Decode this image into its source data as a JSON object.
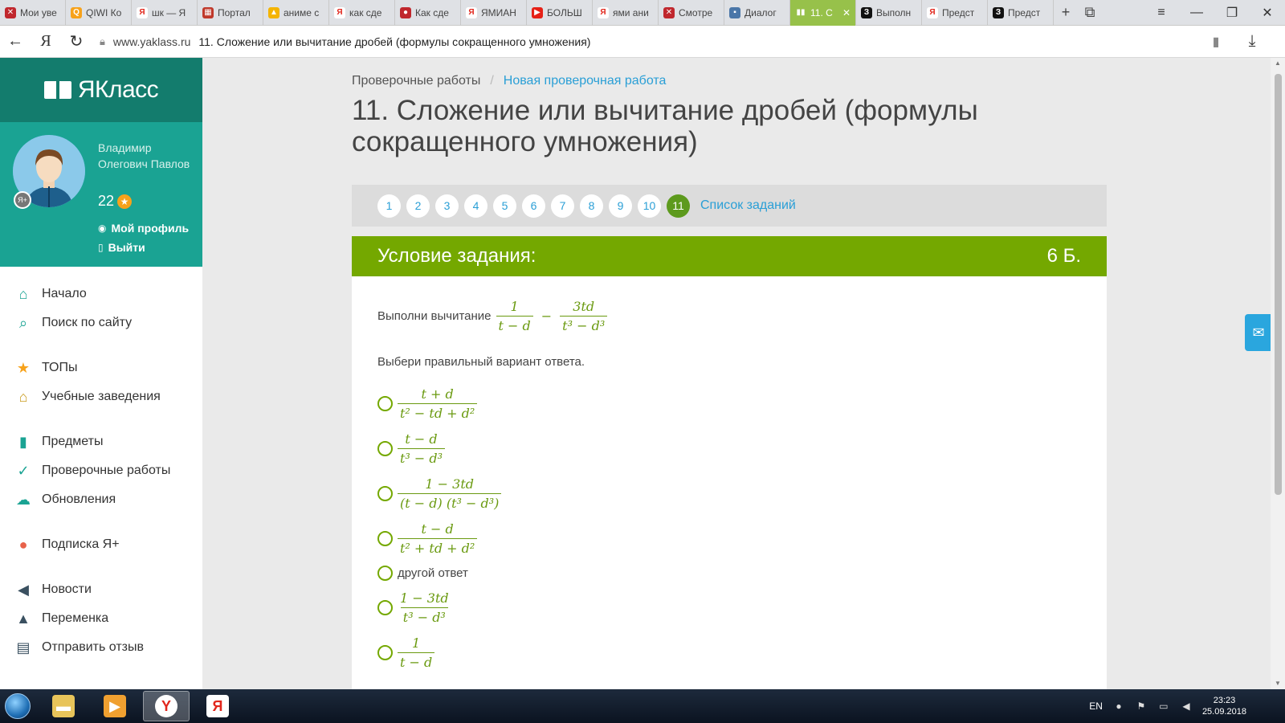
{
  "browser": {
    "tabs": [
      {
        "label": "Мои уве",
        "icon": "opera-icon",
        "color": "#c0272d",
        "glyph": "✕"
      },
      {
        "label": "QIWI Ко",
        "icon": "qiwi-icon",
        "color": "#f7a21b",
        "glyph": "Q"
      },
      {
        "label": "шк — Я",
        "icon": "yandex-icon",
        "color": "#ffffff",
        "glyph": "Я"
      },
      {
        "label": "Портал",
        "icon": "portal-icon",
        "color": "#c0392b",
        "glyph": "▦"
      },
      {
        "label": "аниме с",
        "icon": "image-icon",
        "color": "#f4b400",
        "glyph": "▲"
      },
      {
        "label": "как сде",
        "icon": "yandex-icon",
        "color": "#ffffff",
        "glyph": "Я"
      },
      {
        "label": "Как сде",
        "icon": "record-icon",
        "color": "#c0272d",
        "glyph": "●"
      },
      {
        "label": "ЯМИАН",
        "icon": "yandex-icon",
        "color": "#ffffff",
        "glyph": "Я"
      },
      {
        "label": "БОЛЬШ",
        "icon": "youtube-icon",
        "color": "#e62117",
        "glyph": "▶"
      },
      {
        "label": "ями ани",
        "icon": "yandex-icon",
        "color": "#ffffff",
        "glyph": "Я"
      },
      {
        "label": "Смотре",
        "icon": "opera-icon",
        "color": "#c0272d",
        "glyph": "✕"
      },
      {
        "label": "Диалог",
        "icon": "chat-icon",
        "color": "#4a76a8",
        "glyph": "▪"
      },
      {
        "label": "11. С",
        "icon": "yaklass-icon",
        "color": "#97c14a",
        "glyph": "▮▮",
        "active": true
      },
      {
        "label": "Выполн",
        "icon": "znanija-icon",
        "color": "#111111",
        "glyph": "З"
      },
      {
        "label": "Предст",
        "icon": "yandex-icon",
        "color": "#ffffff",
        "glyph": "Я"
      },
      {
        "label": "Предст",
        "icon": "znanija-icon",
        "color": "#111111",
        "glyph": "З"
      }
    ],
    "address": {
      "domain": "www.yaklass.ru",
      "page_title": "11. Сложение или вычитание дробей (формулы сокращенного умножения)"
    }
  },
  "sidebar": {
    "logo": "ЯКласс",
    "user": {
      "name": "Владимир Олегович Павлов",
      "points": "22",
      "profile_link": "Мой профиль",
      "logout_link": "Выйти"
    },
    "menu": [
      {
        "label": "Начало",
        "icon": "home-icon",
        "glyph": "⌂"
      },
      {
        "label": "Поиск по сайту",
        "icon": "search-icon",
        "glyph": "⌕"
      },
      {
        "label": "ТОПы",
        "icon": "star-icon",
        "glyph": "★"
      },
      {
        "label": "Учебные заведения",
        "icon": "school-icon",
        "glyph": "⌂"
      },
      {
        "label": "Предметы",
        "icon": "books-icon",
        "glyph": "▮"
      },
      {
        "label": "Проверочные работы",
        "icon": "check-circle-icon",
        "glyph": "✓"
      },
      {
        "label": "Обновления",
        "icon": "cloud-icon",
        "glyph": "☁"
      },
      {
        "label": "Подписка Я+",
        "icon": "yaplus-icon",
        "glyph": "●"
      },
      {
        "label": "Новости",
        "icon": "megaphone-icon",
        "glyph": "◀"
      },
      {
        "label": "Переменка",
        "icon": "bell-icon",
        "glyph": "▲"
      },
      {
        "label": "Отправить отзыв",
        "icon": "comment-icon",
        "glyph": "▤"
      }
    ]
  },
  "main": {
    "breadcrumb": {
      "first": "Проверочные работы",
      "sep": "/",
      "second": "Новая проверочная работа"
    },
    "title": "11. Сложение или вычитание дробей (формулы сокращенного умножения)",
    "pager": {
      "pages": [
        "1",
        "2",
        "3",
        "4",
        "5",
        "6",
        "7",
        "8",
        "9",
        "10",
        "11"
      ],
      "active": "11",
      "list_link": "Список заданий"
    },
    "task": {
      "header": "Условие задания:",
      "points": "6 Б.",
      "question_prefix": "Выполни вычитание",
      "question_expr": {
        "f1_num": "1",
        "f1_den": "t − d",
        "op": "−",
        "f2_num": "3td",
        "f2_den": "t³ − d³"
      },
      "instruction": "Выбери правильный вариант ответа.",
      "options": [
        {
          "num": "t + d",
          "den": "t² − td + d²"
        },
        {
          "num": "t − d",
          "den": "t³ − d³"
        },
        {
          "num": "1 − 3td",
          "den": "(t − d) (t³ − d³)"
        },
        {
          "num": "t − d",
          "den": "t² + td + d²"
        },
        {
          "text": "другой ответ"
        },
        {
          "num": "1 − 3td",
          "den": "t³ − d³"
        },
        {
          "num": "1",
          "den": "t − d"
        }
      ]
    }
  },
  "taskbar": {
    "lang": "EN",
    "time": "23:23",
    "date": "25.09.2018"
  }
}
